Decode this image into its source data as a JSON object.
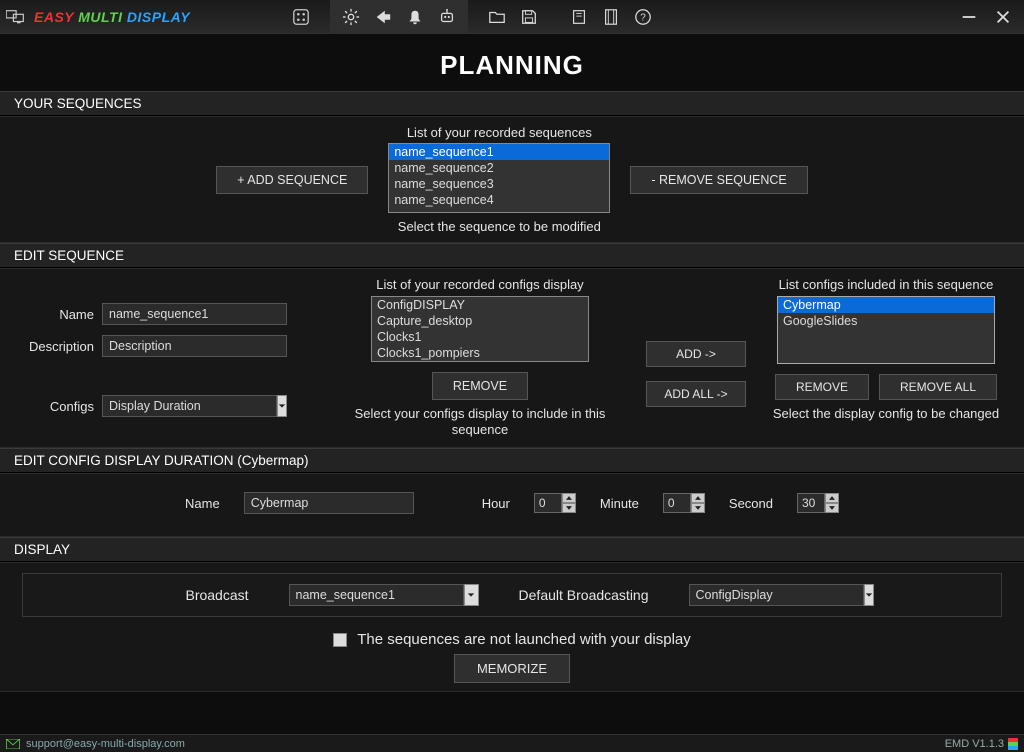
{
  "brand": {
    "w1": "EASY",
    "w2": "MULTI",
    "w3": "DISPLAY"
  },
  "page_title": "PLANNING",
  "sections": {
    "sequences": {
      "header": "YOUR SEQUENCES",
      "list_label": "List of your recorded sequences",
      "list": [
        "name_sequence1",
        "name_sequence2",
        "name_sequence3",
        "name_sequence4"
      ],
      "selected_index": 0,
      "add_btn": "+ ADD SEQUENCE",
      "remove_btn": "- REMOVE SEQUENCE",
      "hint": "Select the sequence to be modified"
    },
    "edit_sequence": {
      "header": "EDIT SEQUENCE",
      "name_label": "Name",
      "name_value": "name_sequence1",
      "desc_label": "Description",
      "desc_value": "Description",
      "configs_label": "Configs",
      "configs_value": "Display Duration",
      "recorded_label": "List of your recorded configs display",
      "recorded_list": [
        "ConfigDISPLAY",
        "Capture_desktop",
        "Clocks1",
        "Clocks1_pompiers"
      ],
      "remove_btn": "REMOVE",
      "recorded_hint": "Select your configs display to include in this sequence",
      "add_btn": "ADD ->",
      "addall_btn": "ADD ALL ->",
      "included_label": "List configs included in this sequence",
      "included_list": [
        "Cybermap",
        "GoogleSlides"
      ],
      "included_selected_index": 0,
      "inc_remove_btn": "REMOVE",
      "inc_removeall_btn": "REMOVE ALL",
      "included_hint": "Select the display config to be changed"
    },
    "edit_duration": {
      "header": "EDIT CONFIG  DISPLAY DURATION (Cybermap)",
      "name_label": "Name",
      "name_value": "Cybermap",
      "hour_label": "Hour",
      "hour_value": "0",
      "minute_label": "Minute",
      "minute_value": "0",
      "second_label": "Second",
      "second_value": "30"
    },
    "display": {
      "header": "DISPLAY",
      "broadcast_label": "Broadcast",
      "broadcast_value": "name_sequence1",
      "default_label": "Default Broadcasting",
      "default_value": "ConfigDisplay",
      "checkbox_label": "The sequences are not launched with your display",
      "checkbox_checked": false,
      "memorize_btn": "MEMORIZE"
    }
  },
  "statusbar": {
    "email": "support@easy-multi-display.com",
    "version": "EMD V1.1.3"
  }
}
